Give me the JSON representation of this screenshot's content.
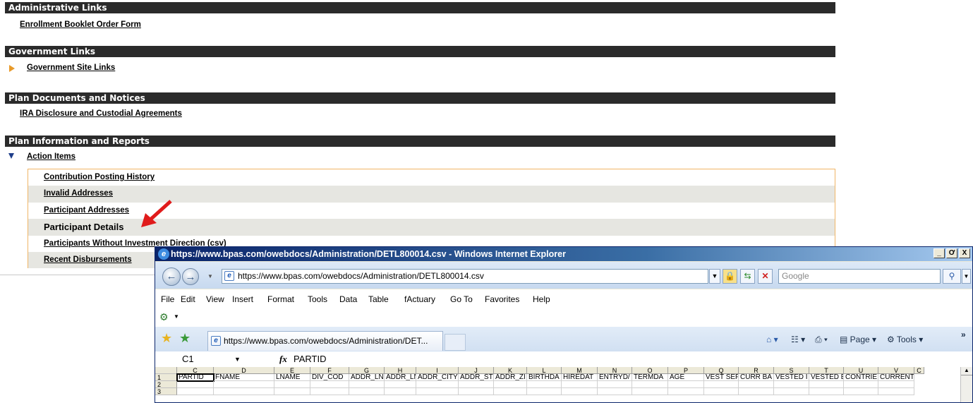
{
  "sections": {
    "admin": {
      "title": "Administrative Links",
      "links": [
        "Enrollment Booklet Order Form"
      ]
    },
    "gov": {
      "title": "Government Links",
      "links": [
        "Government Site Links"
      ]
    },
    "plan_docs": {
      "title": "Plan Documents and Notices",
      "links": [
        "IRA Disclosure and Custodial Agreements"
      ]
    },
    "plan_info": {
      "title": "Plan Information and Reports",
      "group": "Action Items",
      "items": [
        "Contribution Posting History",
        "Invalid Addresses",
        "Participant Addresses",
        "Participant Details",
        "Participants Without Investment Direction (csv)",
        "Recent Disbursements"
      ]
    }
  },
  "ie": {
    "title": "https://www.bpas.com/owebdocs/Administration/DETL800014.csv - Windows Internet Explorer",
    "address": "https://www.bpas.com/owebdocs/Administration/DETL800014.csv",
    "search_placeholder": "Google",
    "menu": [
      "File",
      "Edit",
      "View",
      "Insert",
      "Format",
      "Tools",
      "Data",
      "Table",
      "fActuary",
      "Go To",
      "Favorites",
      "Help"
    ],
    "tab_title": "https://www.bpas.com/owebdocs/Administration/DET...",
    "commands": {
      "page": "Page",
      "tools": "Tools"
    },
    "window_buttons": [
      "_",
      "Ơ",
      "X"
    ]
  },
  "spreadsheet": {
    "name_box": "C1",
    "fx": "fx",
    "formula": "PARTID",
    "columns": [
      "C",
      "D",
      "E",
      "F",
      "G",
      "H",
      "I",
      "J",
      "K",
      "L",
      "M",
      "N",
      "O",
      "P",
      "Q",
      "R",
      "S",
      "T",
      "U",
      "V"
    ],
    "row_numbers": [
      "1",
      "2",
      "3"
    ],
    "row1": [
      "PARTID",
      "FNAME",
      "LNAME",
      "DIV_COD",
      "ADDR_LN1",
      "ADDR_LN2",
      "ADDR_CITY",
      "ADDR_ST",
      "ADDR_ZI",
      "BIRTHDA",
      "HIREDAT",
      "ENTRYD/",
      "TERMDA",
      "AGE",
      "VEST SEF",
      "CURR BA",
      "VESTED I",
      "VESTED E",
      "CONTRIE",
      "CURRENT"
    ],
    "trailing_col": "C"
  },
  "colors": {
    "section_bar": "#2b2b2b",
    "action_border": "#f0b566",
    "shade_row": "#e6e6e1",
    "annotation_arrow": "#e01b1b"
  }
}
